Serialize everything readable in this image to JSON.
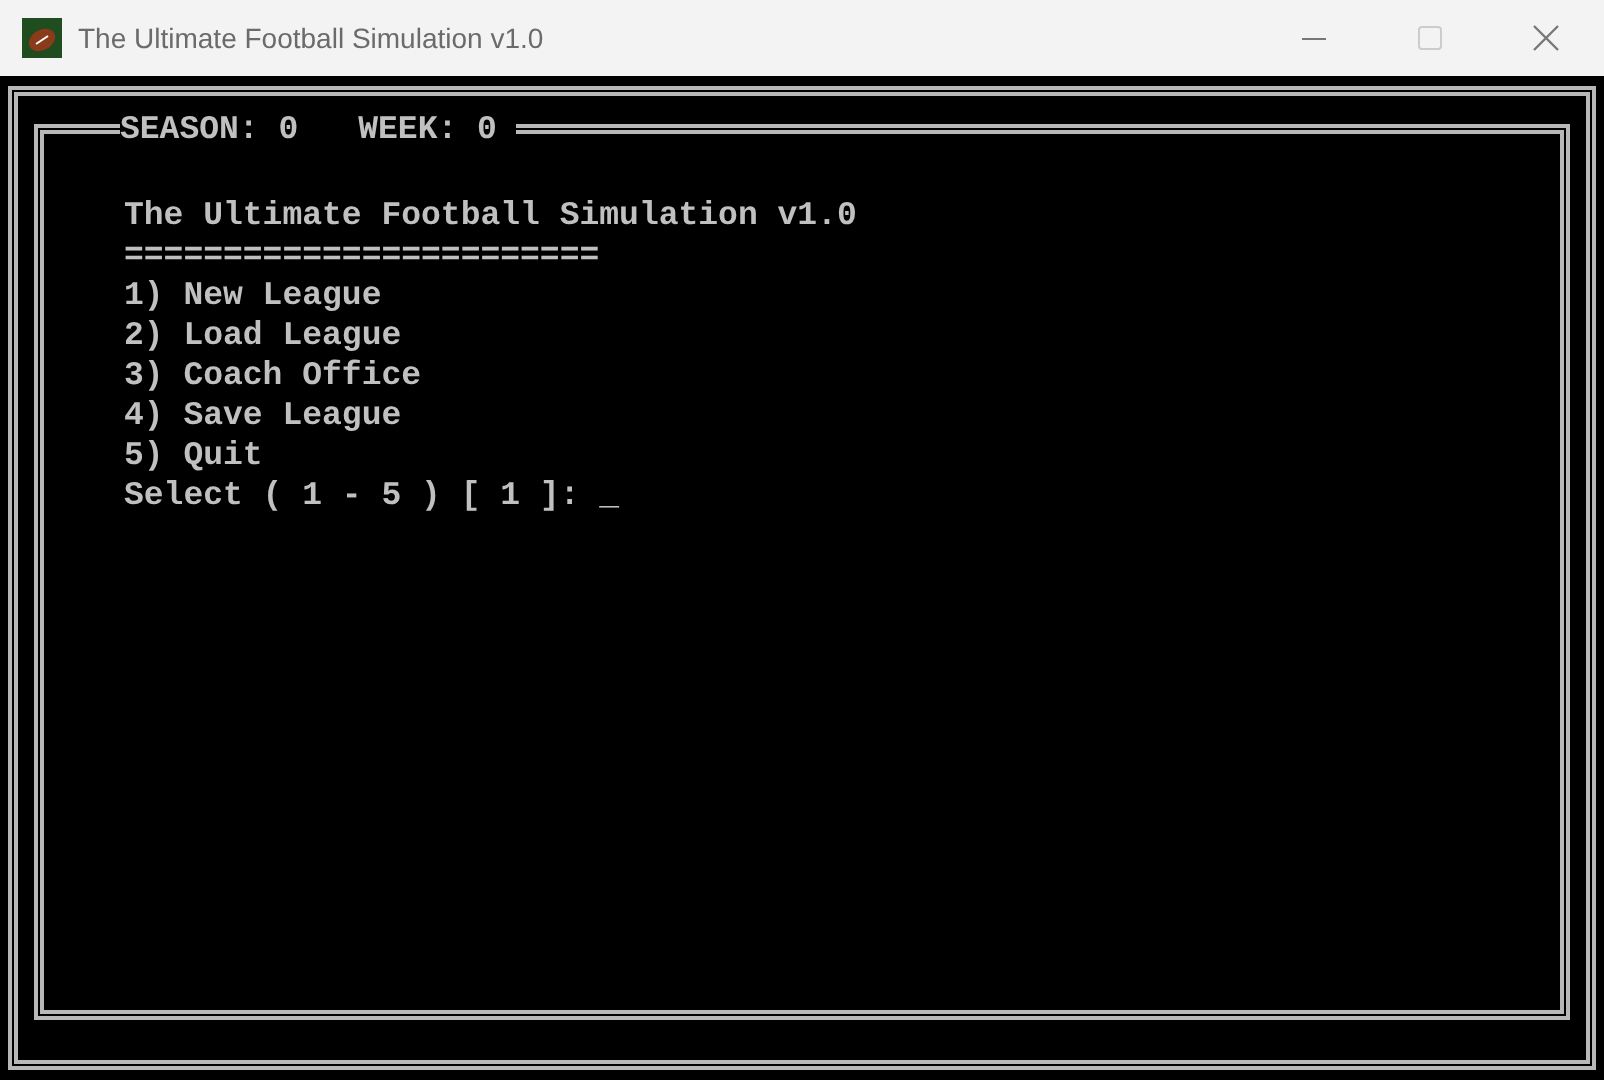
{
  "window": {
    "title": "The Ultimate Football Simulation v1.0"
  },
  "header": {
    "season_label": "SEASON:",
    "season": "0",
    "week_label": "WEEK:",
    "week": "0"
  },
  "heading": "The Ultimate Football Simulation v1.0",
  "underline": "========================",
  "menu": [
    {
      "key": "1)",
      "label": "New League"
    },
    {
      "key": "2)",
      "label": "Load League"
    },
    {
      "key": "3)",
      "label": "Coach Office"
    },
    {
      "key": "4)",
      "label": "Save League"
    },
    {
      "key": "5)",
      "label": "Quit"
    }
  ],
  "prompt": {
    "text": "Select ( 1 - 5 ) [ 1 ]:",
    "cursor": "_"
  }
}
